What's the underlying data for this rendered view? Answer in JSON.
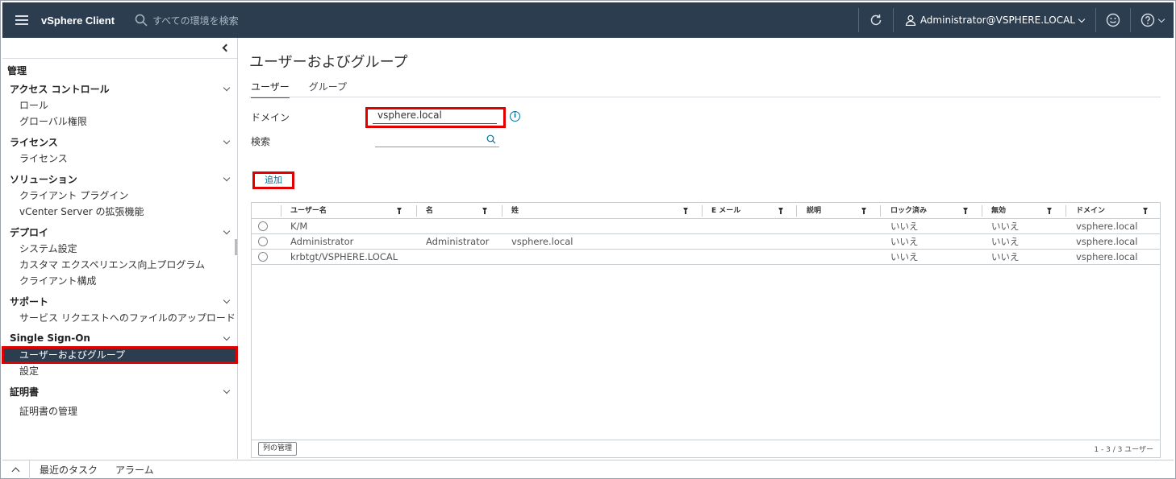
{
  "header": {
    "title": "vSphere Client",
    "search_placeholder": "すべての環境を検索",
    "user": "Administrator@VSPHERE.LOCAL"
  },
  "sidebar": {
    "root": "管理",
    "sections": [
      {
        "title": "アクセス コントロール",
        "items": [
          "ロール",
          "グローバル権限"
        ]
      },
      {
        "title": "ライセンス",
        "items": [
          "ライセンス"
        ]
      },
      {
        "title": "ソリューション",
        "items": [
          "クライアント プラグイン",
          "vCenter Server の拡張機能"
        ]
      },
      {
        "title": "デプロイ",
        "items": [
          "システム設定",
          "カスタマ エクスペリエンス向上プログラム",
          "クライアント構成"
        ]
      },
      {
        "title": "サポート",
        "items": [
          "サービス リクエストへのファイルのアップロード"
        ]
      },
      {
        "title": "Single Sign-On",
        "items": [
          "ユーザーおよびグループ",
          "設定"
        ]
      },
      {
        "title": "証明書",
        "items": [
          "証明書の管理"
        ]
      }
    ]
  },
  "main": {
    "title": "ユーザーおよびグループ",
    "tabs": [
      "ユーザー",
      "グループ"
    ],
    "domain_label": "ドメイン",
    "domain_value": "vsphere.local",
    "search_label": "検索",
    "add_button": "追加",
    "columns": [
      "ユーザー名",
      "名",
      "姓",
      "E メール",
      "説明",
      "ロック済み",
      "無効",
      "ドメイン"
    ],
    "rows": [
      [
        "K/M",
        "",
        "",
        "",
        "",
        "いいえ",
        "いいえ",
        "vsphere.local"
      ],
      [
        "Administrator",
        "Administrator",
        "vsphere.local",
        "",
        "",
        "いいえ",
        "いいえ",
        "vsphere.local"
      ],
      [
        "krbtgt/VSPHERE.LOCAL",
        "",
        "",
        "",
        "",
        "いいえ",
        "いいえ",
        "vsphere.local"
      ]
    ],
    "manage_columns": "列の管理",
    "count": "1 - 3 / 3 ユーザー"
  },
  "bottom": {
    "recent_tasks": "最近のタスク",
    "alarms": "アラーム"
  }
}
